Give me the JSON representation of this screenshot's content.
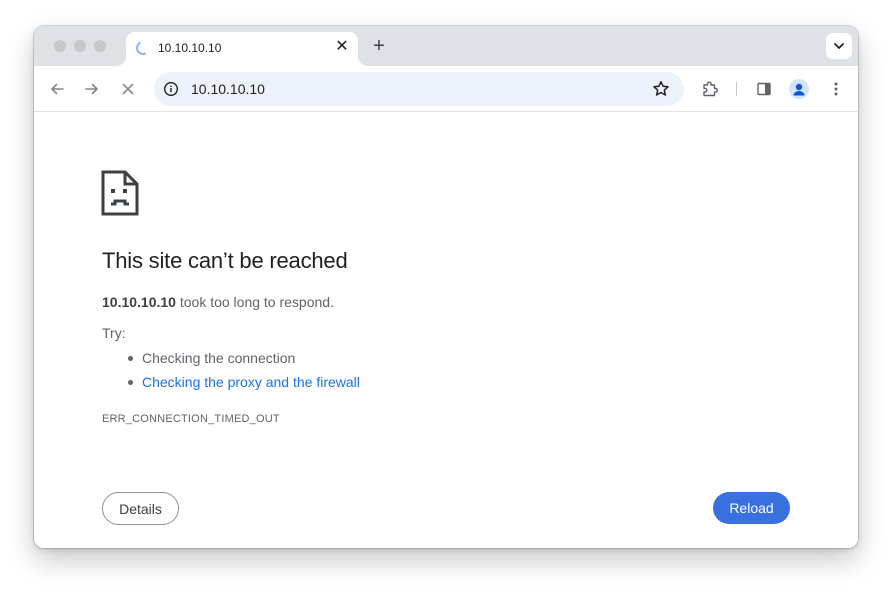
{
  "tab": {
    "title": "10.10.10.10",
    "close_glyph": "✕",
    "new_tab_glyph": "+",
    "loading_indicator": "spinner-icon"
  },
  "toolbar": {
    "url": "10.10.10.10",
    "icons": [
      "back-arrow-icon",
      "forward-arrow-icon",
      "stop-loading-icon",
      "info-icon",
      "bookmark-star-icon",
      "extensions-puzzle-icon",
      "side-panel-icon",
      "profile-avatar-icon",
      "more-menu-icon"
    ]
  },
  "error_page": {
    "title": "This site can’t be reached",
    "host": "10.10.10.10",
    "message": " took too long to respond.",
    "try_label": "Try:",
    "suggestions": [
      {
        "text": "Checking the connection",
        "is_link": false
      },
      {
        "text": "Checking the proxy and the firewall",
        "is_link": true
      }
    ],
    "error_code": "ERR_CONNECTION_TIMED_OUT",
    "details_label": "Details",
    "reload_label": "Reload"
  },
  "colors": {
    "tabstrip": "#dee1e6",
    "omnibox": "#edf2fa",
    "link": "#1a73e8",
    "reload_button": "#3870e0",
    "text_primary": "#202124",
    "text_secondary": "#5f6368"
  }
}
